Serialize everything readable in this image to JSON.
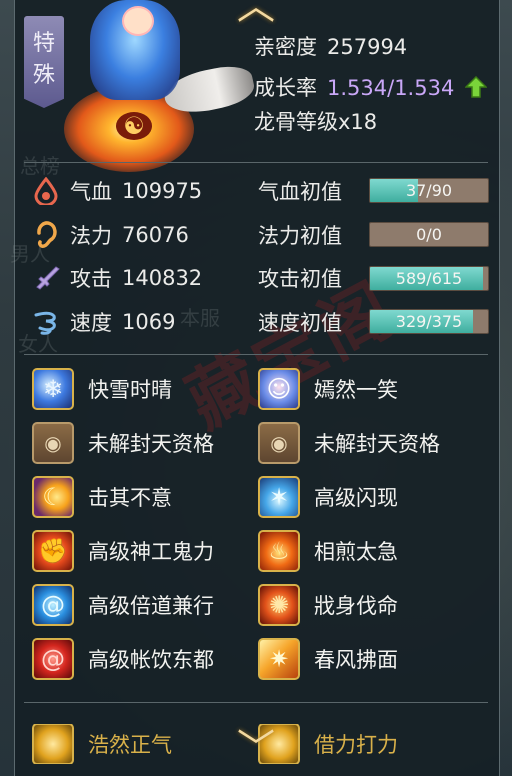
{
  "pet": {
    "special_tag": "特殊",
    "closeness_label": "亲密度",
    "closeness_value": "257994",
    "growth_label": "成长率",
    "growth_value": "1.534/1.534",
    "dragon_bone": "龙骨等级x18"
  },
  "stats": [
    {
      "icon": "blood-drop-icon",
      "label": "气血",
      "value": "109975",
      "init_label": "气血初值",
      "init_text": "37/90",
      "init_fraction": 0.41
    },
    {
      "icon": "ear-icon",
      "label": "法力",
      "value": "76076",
      "init_label": "法力初值",
      "init_text": "0/0",
      "init_fraction": 0
    },
    {
      "icon": "sword-icon",
      "label": "攻击",
      "value": "140832",
      "init_label": "攻击初值",
      "init_text": "589/615",
      "init_fraction": 0.958
    },
    {
      "icon": "wind-icon",
      "label": "速度",
      "value": "1069",
      "init_label": "速度初值",
      "init_text": "329/375",
      "init_fraction": 0.877
    }
  ],
  "skills": [
    {
      "name": "快雪时晴",
      "icon": "snow-skill-icon"
    },
    {
      "name": "嫣然一笑",
      "icon": "smile-skill-icon"
    },
    {
      "name": "未解封天资格",
      "icon": "locked-bag-icon"
    },
    {
      "name": "未解封天资格",
      "icon": "locked-bag-icon"
    },
    {
      "name": "击其不意",
      "icon": "slash-skill-icon"
    },
    {
      "name": "高级闪现",
      "icon": "flash-skill-icon"
    },
    {
      "name": "高级神工鬼力",
      "icon": "fire-fist-skill-icon"
    },
    {
      "name": "相煎太急",
      "icon": "flame-skill-icon"
    },
    {
      "name": "高级倍道兼行",
      "icon": "water-swirl-skill-icon"
    },
    {
      "name": "戕身伐命",
      "icon": "tiger-skill-icon"
    },
    {
      "name": "高级帐饮东都",
      "icon": "red-swirl-skill-icon"
    },
    {
      "name": "春风拂面",
      "icon": "spring-wind-skill-icon"
    },
    {
      "name": "浩然正气",
      "icon": "gold-skill-icon"
    },
    {
      "name": "借力打力",
      "icon": "gold-skill-icon"
    }
  ],
  "colors": {
    "bar_fill": "#4fbfb0",
    "bar_track": "#8e7b6c",
    "growth": "#c9a7f7",
    "frame_gold": "#d8b24a"
  }
}
